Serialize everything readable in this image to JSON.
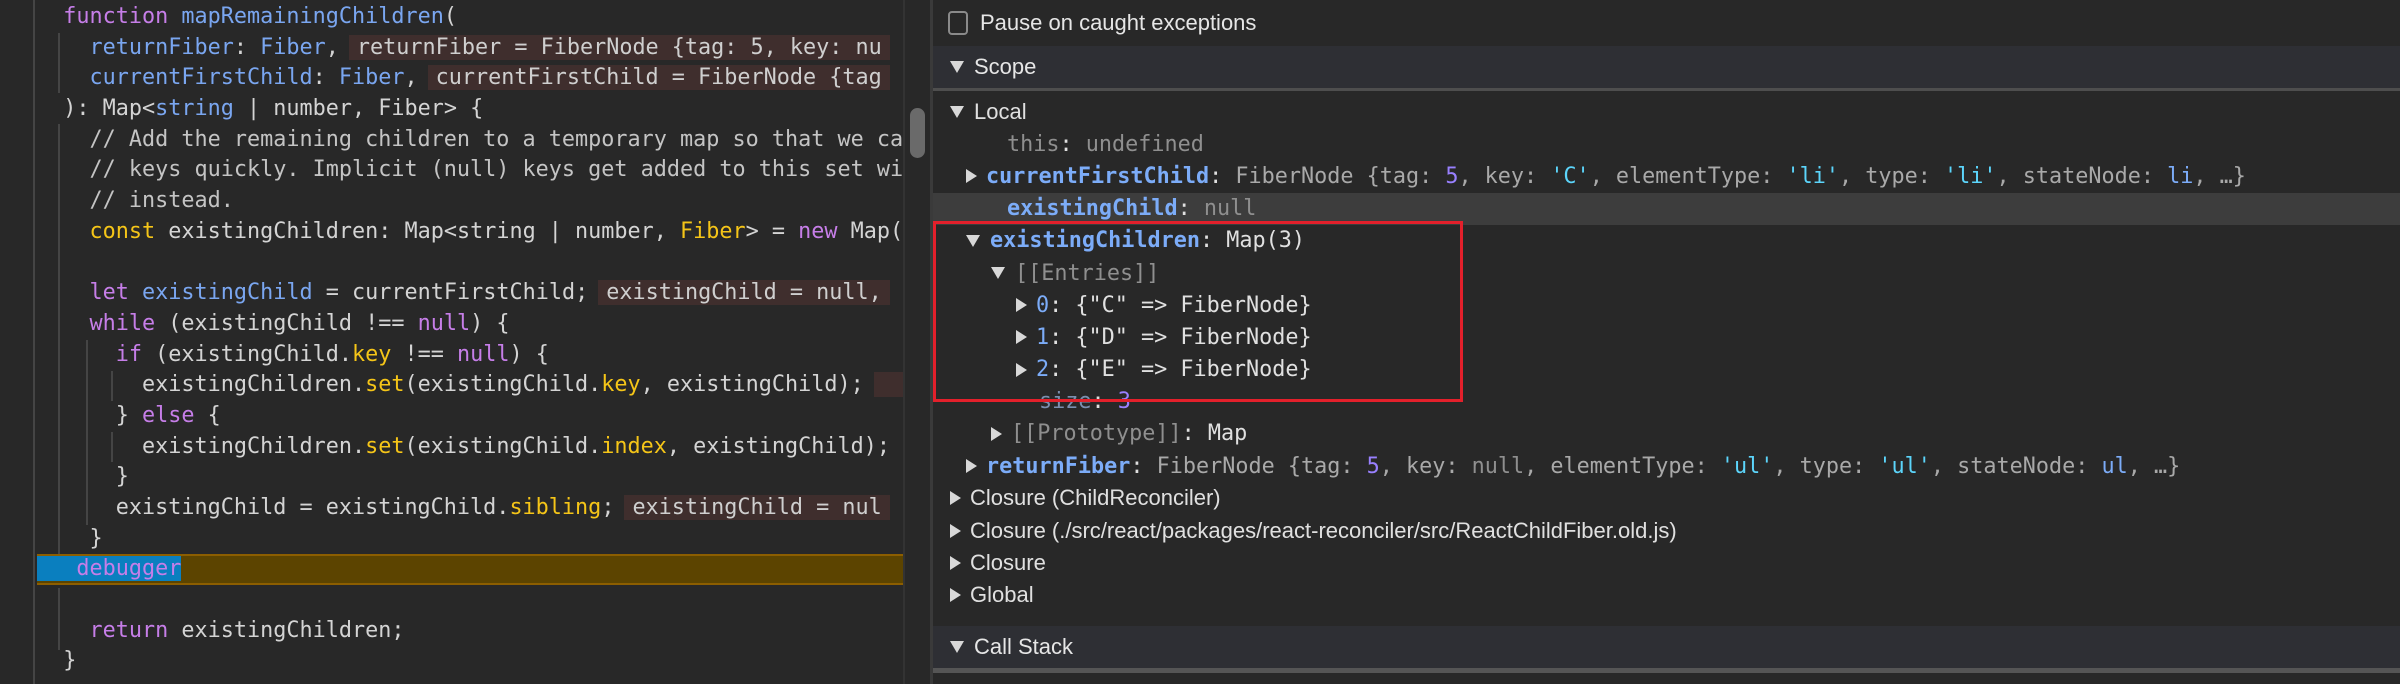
{
  "editor": {
    "lines": [
      {
        "tokens": [
          [
            "t-tx",
            "  "
          ],
          [
            "t-kw",
            "function"
          ],
          [
            "t-tx",
            " "
          ],
          [
            "t-fn",
            "mapRemainingChildren"
          ],
          [
            "t-tx",
            "("
          ]
        ]
      },
      {
        "tokens": [
          [
            "t-tx",
            "    "
          ],
          [
            "t-par",
            "returnFiber"
          ],
          [
            "t-tx",
            ": "
          ],
          [
            "t-ty",
            "Fiber"
          ],
          [
            "t-tx",
            ","
          ]
        ],
        "inline": "returnFiber = FiberNode {tag: 5, key: nu"
      },
      {
        "tokens": [
          [
            "t-tx",
            "    "
          ],
          [
            "t-par",
            "currentFirstChild"
          ],
          [
            "t-tx",
            ": "
          ],
          [
            "t-ty",
            "Fiber"
          ],
          [
            "t-tx",
            ","
          ]
        ],
        "inline": "currentFirstChild = FiberNode {tag"
      },
      {
        "tokens": [
          [
            "t-tx",
            "  ): Map<"
          ],
          [
            "t-ty",
            "string"
          ],
          [
            "t-tx",
            " | number, Fiber> {"
          ]
        ]
      },
      {
        "tokens": [
          [
            "t-cm",
            "    // Add the remaining children to a temporary map so that we ca"
          ]
        ]
      },
      {
        "tokens": [
          [
            "t-cm",
            "    // keys quickly. Implicit (null) keys get added to this set wi"
          ]
        ]
      },
      {
        "tokens": [
          [
            "t-cm",
            "    // instead."
          ]
        ]
      },
      {
        "tokens": [
          [
            "t-tx",
            "    "
          ],
          [
            "t-y",
            "const"
          ],
          [
            "t-tx",
            " existingChildren: Map<string | number, "
          ],
          [
            "t-y",
            "Fiber"
          ],
          [
            "t-tx",
            "> = "
          ],
          [
            "t-kw",
            "new"
          ],
          [
            "t-tx",
            " Map("
          ]
        ]
      },
      {
        "tokens": []
      },
      {
        "tokens": [
          [
            "t-tx",
            "    "
          ],
          [
            "t-kw",
            "let"
          ],
          [
            "t-tx",
            " "
          ],
          [
            "t-par",
            "existingChild"
          ],
          [
            "t-tx",
            " = currentFirstChild;"
          ]
        ],
        "inline": "existingChild = null,"
      },
      {
        "tokens": [
          [
            "t-tx",
            "    "
          ],
          [
            "t-kw",
            "while"
          ],
          [
            "t-tx",
            " (existingChild !== "
          ],
          [
            "t-kw",
            "null"
          ],
          [
            "t-tx",
            ") {"
          ]
        ]
      },
      {
        "tokens": [
          [
            "t-tx",
            "      "
          ],
          [
            "t-kw",
            "if"
          ],
          [
            "t-tx",
            " (existingChild."
          ],
          [
            "t-y",
            "key"
          ],
          [
            "t-tx",
            " !== "
          ],
          [
            "t-kw",
            "null"
          ],
          [
            "t-tx",
            ") {"
          ]
        ]
      },
      {
        "tokens": [
          [
            "t-tx",
            "        existingChildren."
          ],
          [
            "t-y",
            "set"
          ],
          [
            "t-tx",
            "(existingChild."
          ],
          [
            "t-y",
            "key"
          ],
          [
            "t-tx",
            ", existingChild);"
          ]
        ],
        "inline": " "
      },
      {
        "tokens": [
          [
            "t-tx",
            "      } "
          ],
          [
            "t-kw",
            "else"
          ],
          [
            "t-tx",
            " {"
          ]
        ]
      },
      {
        "tokens": [
          [
            "t-tx",
            "        existingChildren."
          ],
          [
            "t-y",
            "set"
          ],
          [
            "t-tx",
            "(existingChild."
          ],
          [
            "t-y",
            "index"
          ],
          [
            "t-tx",
            ", existingChild);"
          ]
        ]
      },
      {
        "tokens": [
          [
            "t-tx",
            "      }"
          ]
        ]
      },
      {
        "tokens": [
          [
            "t-tx",
            "      existingChild = existingChild."
          ],
          [
            "t-y",
            "sibling"
          ],
          [
            "t-tx",
            ";"
          ]
        ],
        "inline": "existingChild = nul"
      },
      {
        "tokens": [
          [
            "t-tx",
            "    }"
          ]
        ]
      },
      {
        "tokens": [
          [
            "t-kw",
            "   debugger"
          ]
        ],
        "paused": true
      },
      {
        "tokens": []
      },
      {
        "tokens": [
          [
            "t-tx",
            "    "
          ],
          [
            "t-kw",
            "return"
          ],
          [
            "t-tx",
            " existingChildren;"
          ]
        ]
      },
      {
        "tokens": [
          [
            "t-tx",
            "  }"
          ]
        ]
      }
    ]
  },
  "panel": {
    "pause_caught_label": "Pause on caught exceptions",
    "pause_caught_checked": false,
    "scope_label": "Scope",
    "call_stack_label": "Call Stack",
    "scope_rows": [
      {
        "level": 0,
        "arrow": "down",
        "header": true,
        "segs": [
          [
            "k-txt",
            "Local"
          ]
        ]
      },
      {
        "level": 2,
        "segs": [
          [
            "k-dim",
            "this"
          ],
          [
            "k-txt",
            ": "
          ],
          [
            "k-dim",
            "undefined"
          ]
        ]
      },
      {
        "level": 1,
        "arrow": "right",
        "segs": [
          [
            "k-name",
            "currentFirstChild"
          ],
          [
            "k-txt",
            ": "
          ],
          [
            "k-prev",
            "FiberNode {tag: "
          ],
          [
            "k-num",
            "5"
          ],
          [
            "k-prev",
            ", key: "
          ],
          [
            "k-str",
            "'C'"
          ],
          [
            "k-prev",
            ", elementType: "
          ],
          [
            "k-str",
            "'li'"
          ],
          [
            "k-prev",
            ", type: "
          ],
          [
            "k-str",
            "'li'"
          ],
          [
            "k-prev",
            ", stateNode: "
          ],
          [
            "k-ul",
            "li"
          ],
          [
            "k-prev",
            ", …}"
          ]
        ]
      },
      {
        "level": 2,
        "highlight": true,
        "segs": [
          [
            "k-name",
            "existingChild"
          ],
          [
            "k-txt",
            ": "
          ],
          [
            "k-dim",
            "null"
          ]
        ]
      },
      {
        "level": 1,
        "arrow": "down",
        "segs": [
          [
            "k-name",
            "existingChildren"
          ],
          [
            "k-txt",
            ": Map(3)"
          ]
        ]
      },
      {
        "level": 3,
        "arrow": "down",
        "segs": [
          [
            "k-dim",
            "[[Entries]]"
          ]
        ]
      },
      {
        "level": 4,
        "arrow": "right",
        "segs": [
          [
            "k-ul",
            "0"
          ],
          [
            "k-txt",
            ": {\"C\" => FiberNode}"
          ]
        ]
      },
      {
        "level": 4,
        "arrow": "right",
        "segs": [
          [
            "k-ul",
            "1"
          ],
          [
            "k-txt",
            ": {\"D\" => FiberNode}"
          ]
        ]
      },
      {
        "level": 4,
        "arrow": "right",
        "segs": [
          [
            "k-ul",
            "2"
          ],
          [
            "k-txt",
            ": {\"E\" => FiberNode}"
          ]
        ]
      },
      {
        "level": 5,
        "segs": [
          [
            "k-size",
            "size"
          ],
          [
            "k-txt",
            ": "
          ],
          [
            "k-num",
            "3"
          ]
        ]
      },
      {
        "level": 3,
        "arrow": "right",
        "segs": [
          [
            "k-dim",
            "[[Prototype]]"
          ],
          [
            "k-txt",
            ": Map"
          ]
        ]
      },
      {
        "level": 1,
        "arrow": "right",
        "segs": [
          [
            "k-name",
            "returnFiber"
          ],
          [
            "k-txt",
            ": "
          ],
          [
            "k-prev",
            "FiberNode {tag: "
          ],
          [
            "k-num",
            "5"
          ],
          [
            "k-prev",
            ", key: "
          ],
          [
            "k-dim",
            "null"
          ],
          [
            "k-prev",
            ", elementType: "
          ],
          [
            "k-str",
            "'ul'"
          ],
          [
            "k-prev",
            ", type: "
          ],
          [
            "k-str",
            "'ul'"
          ],
          [
            "k-prev",
            ", stateNode: "
          ],
          [
            "k-ul",
            "ul"
          ],
          [
            "k-prev",
            ", …}"
          ]
        ]
      },
      {
        "level": 0,
        "arrow": "right",
        "header": true,
        "segs": [
          [
            "k-txt",
            "Closure (ChildReconciler)"
          ]
        ]
      },
      {
        "level": 0,
        "arrow": "right",
        "header": true,
        "segs": [
          [
            "k-txt",
            "Closure (./src/react/packages/react-reconciler/src/ReactChildFiber.old.js)"
          ]
        ]
      },
      {
        "level": 0,
        "arrow": "right",
        "header": true,
        "segs": [
          [
            "k-txt",
            "Closure"
          ]
        ]
      },
      {
        "level": 0,
        "arrow": "right",
        "header": true,
        "segs": [
          [
            "k-txt",
            "Global"
          ]
        ]
      }
    ],
    "highlight_color": "#e3202b"
  }
}
